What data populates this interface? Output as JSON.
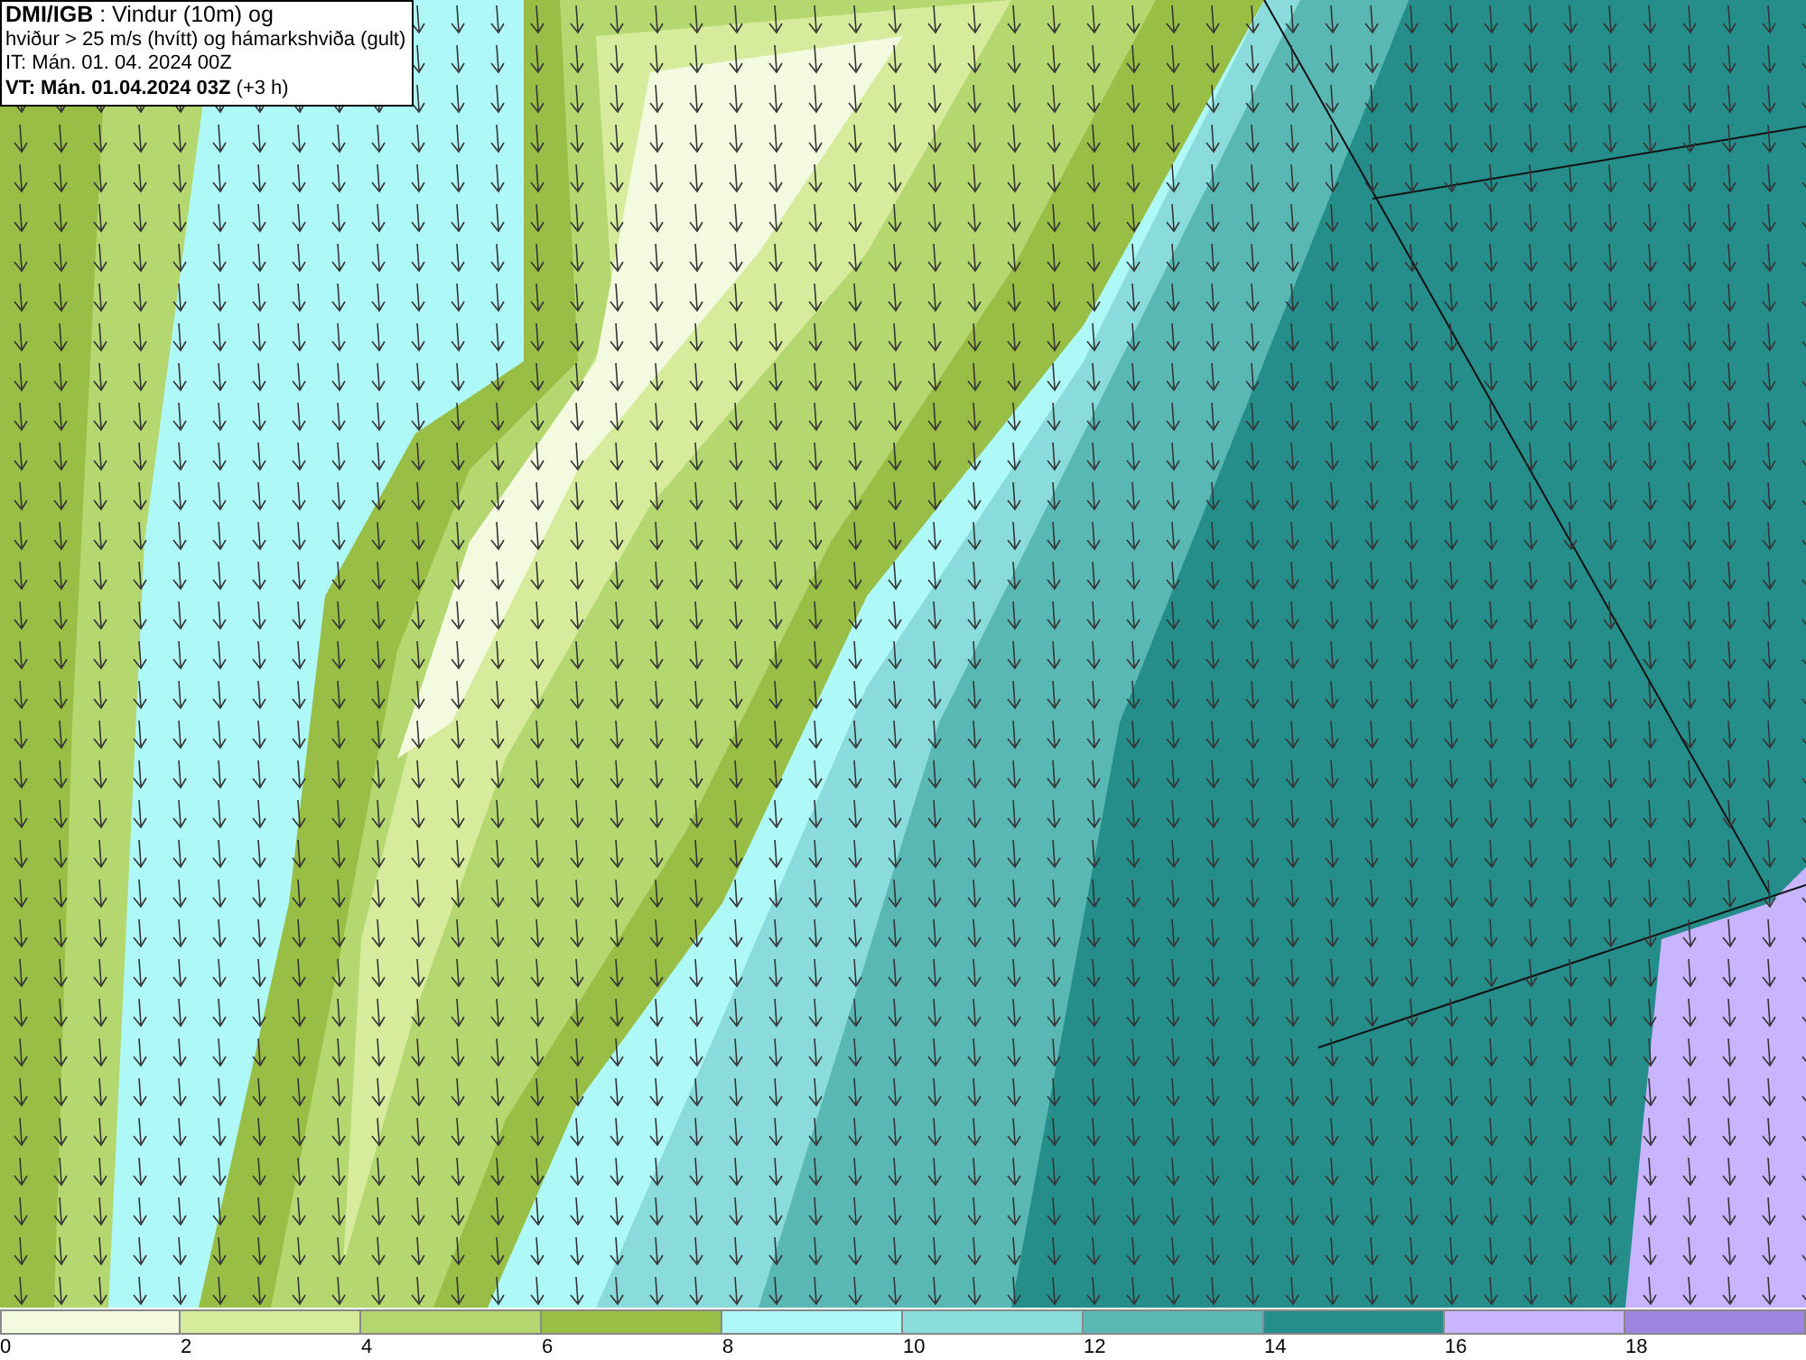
{
  "header": {
    "lines": [
      "**DMI/IGB** : Vindur (10m) og",
      "hviður > 25 m/s (hvítt) og hámarkshviða (gult)",
      "IT: Mán. 01. 04. 2024 00Z",
      "**VT: Mán. 01.04.2024 03Z** (+3 h)"
    ]
  },
  "legend": [
    {
      "label": "0",
      "color": "#f4fae0"
    },
    {
      "label": "2",
      "color": "#d6eb9c"
    },
    {
      "label": "4",
      "color": "#b5d770"
    },
    {
      "label": "6",
      "color": "#98be45"
    },
    {
      "label": "8",
      "color": "#aef8f8"
    },
    {
      "label": "10",
      "color": "#8adcdc"
    },
    {
      "label": "12",
      "color": "#5ab8b4"
    },
    {
      "label": "14",
      "color": "#258e8a"
    },
    {
      "label": "16",
      "color": "#c8b4ff"
    },
    {
      "label": "18",
      "color": "#9c84e0"
    }
  ]
}
